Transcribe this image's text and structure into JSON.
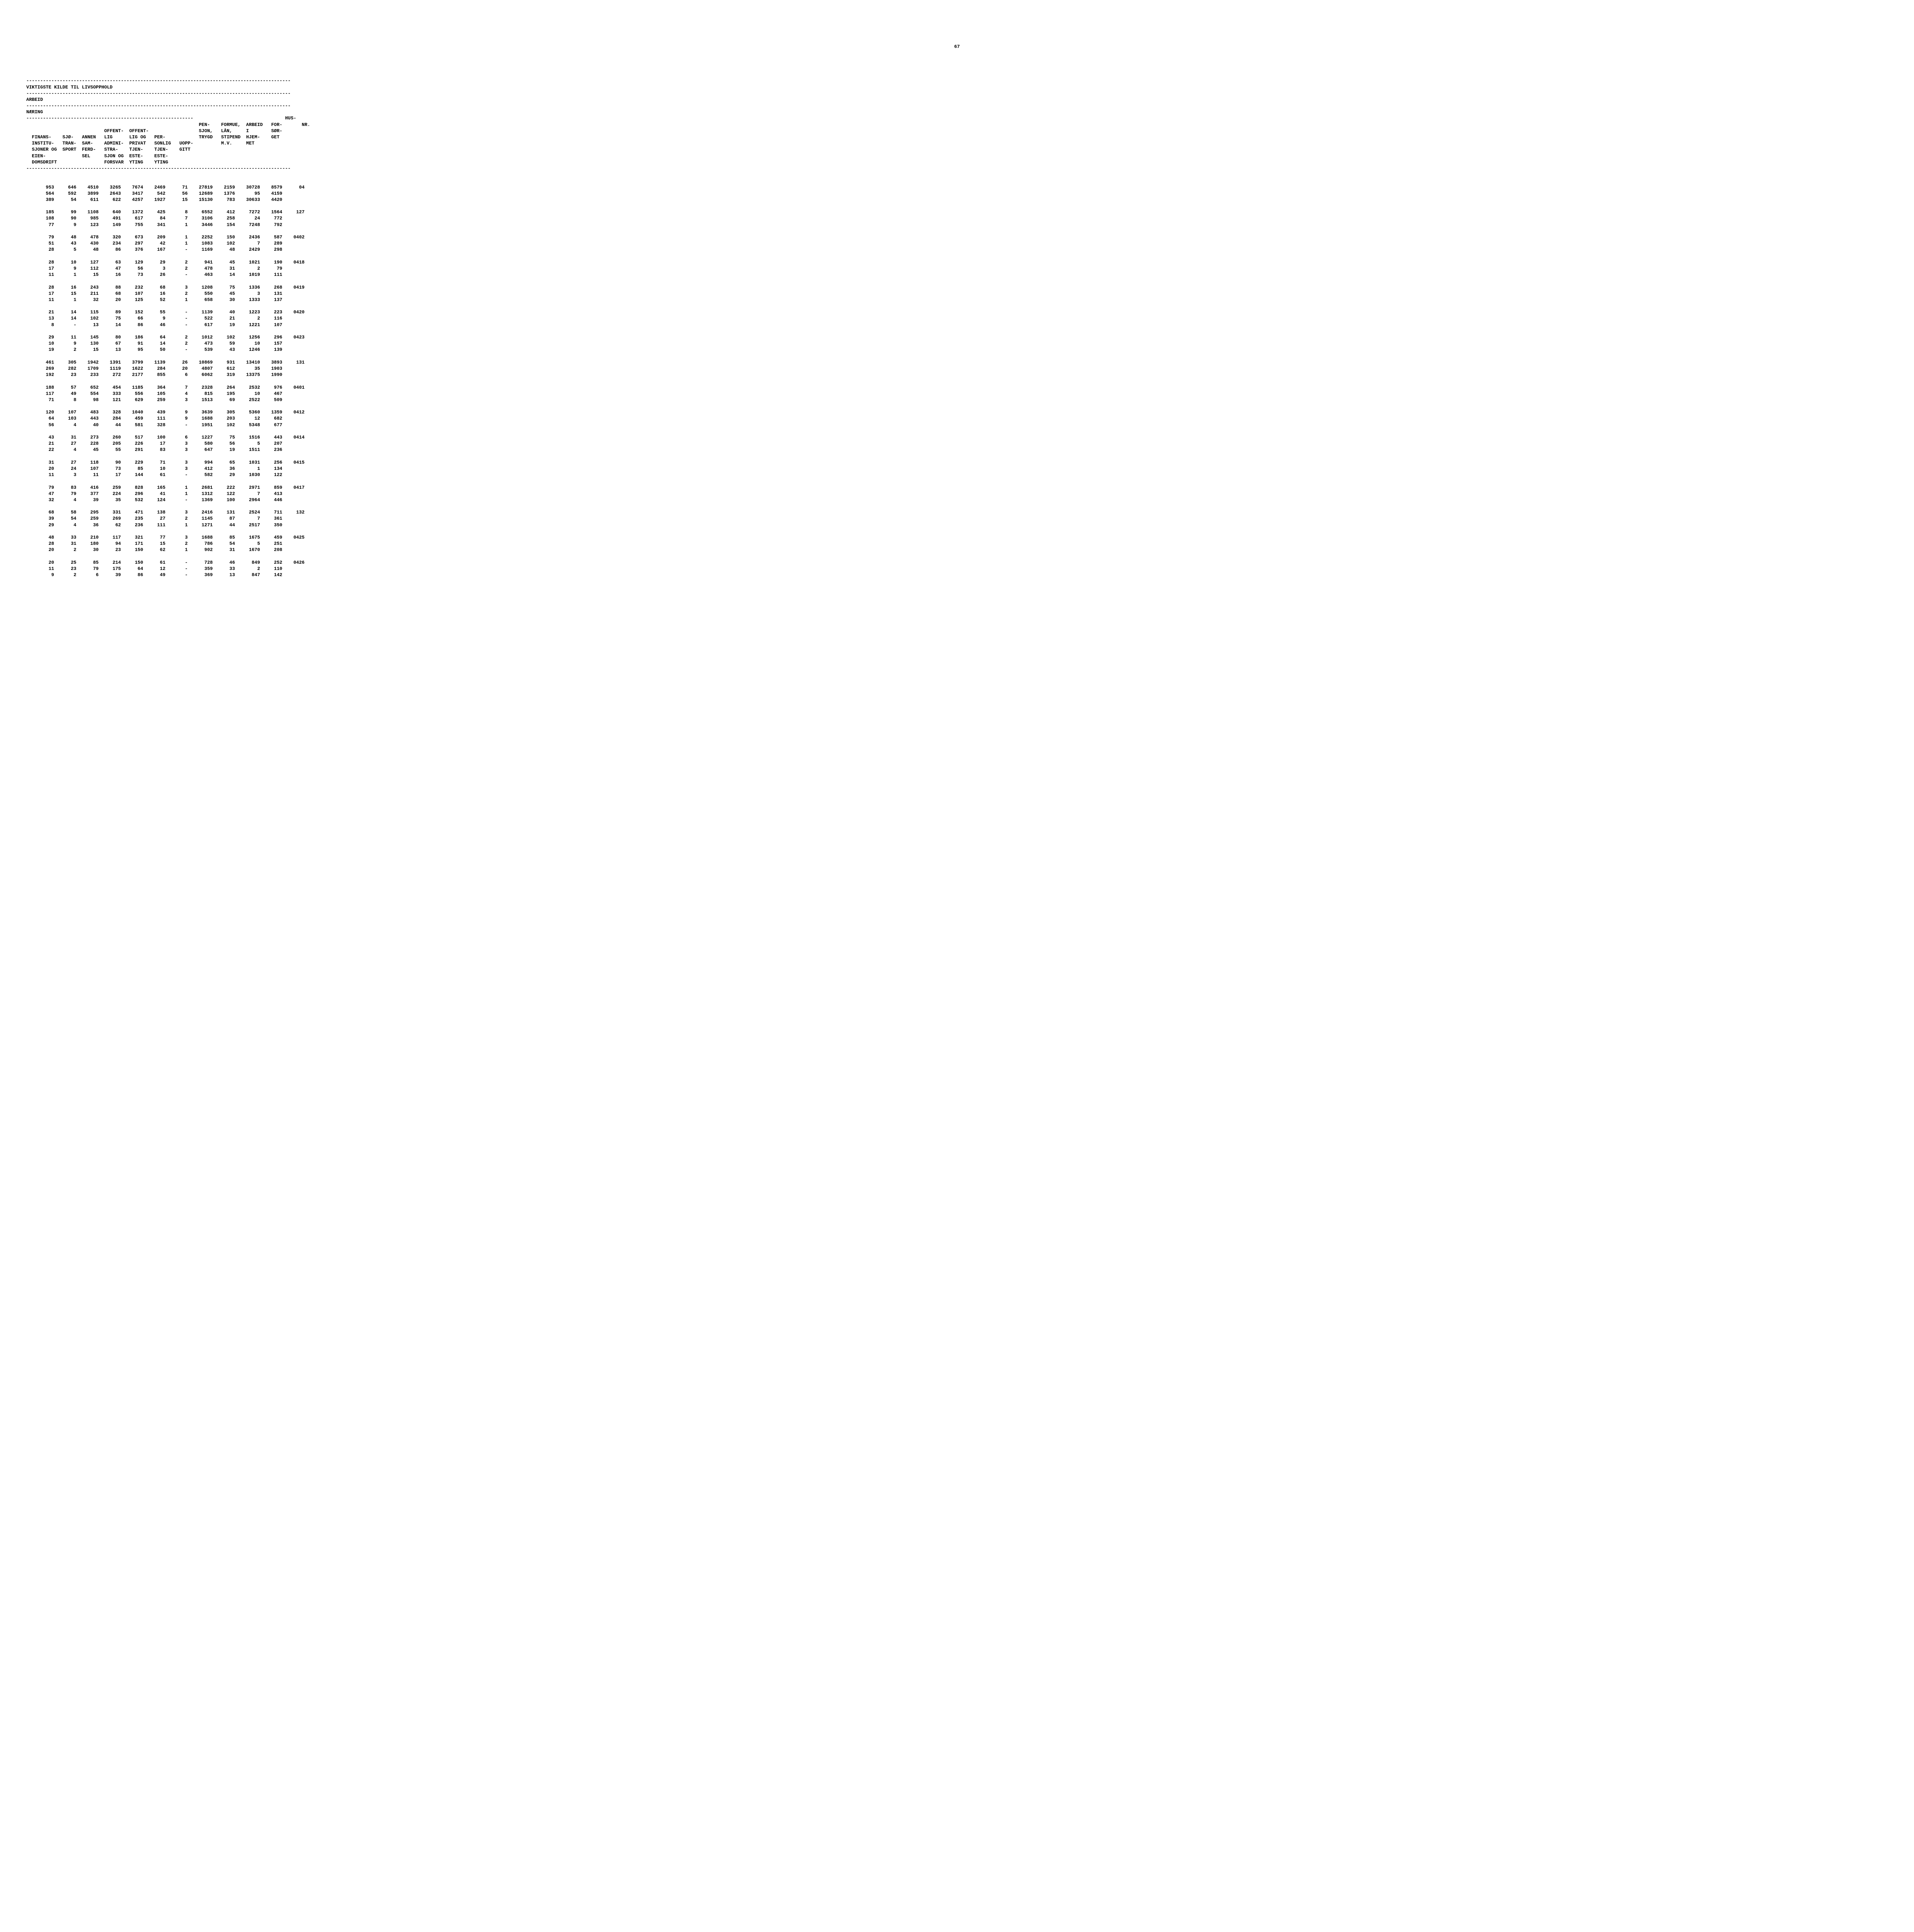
{
  "page_number": "67",
  "title": "VIKTIGSTE KILDE TIL LIVSOPPHOLD",
  "section1": "ARBEID",
  "section2": "NÆRING",
  "headers": {
    "col1": "FINANS-\nINSTITU-\nSJONER OG\nEIEN-\nDOMSDRIFT",
    "col2": "SJØ-\nTRAN-\nSPORT",
    "col3": "ANNEN\nSAM-\nFERD-\nSEL",
    "col4": "OFFENT-\nLIG\nADMINI-\nSTRA-\nSJON OG\nFORSVAR",
    "col5": "OFFENT-\nLIG OG\nPRIVAT\nTJEN-\nESTE-\nYTING",
    "col6": "PER-\nSONLIG\nTJEN-\nESTE-\nYTING",
    "col7": "UOPP-\nGITT",
    "col8": "PEN-\nSJON,\nTRYGD",
    "col9": "FORMUE,\nLÅN,\nSTIPEND\nM.V.",
    "col10": "HUS-\nARBEID\nI\nHJEM-\nMET",
    "col11": "FOR-\nSØR-\nGET",
    "col12": "NR."
  },
  "chart_data": {
    "type": "table",
    "rows": [
      {
        "c1": "953",
        "c2": "646",
        "c3": "4510",
        "c4": "3265",
        "c5": "7674",
        "c6": "2469",
        "c7": "71",
        "c8": "27819",
        "c9": "2159",
        "c10": "30728",
        "c11": "8579",
        "c12": "04"
      },
      {
        "c1": "564",
        "c2": "592",
        "c3": "3899",
        "c4": "2643",
        "c5": "3417",
        "c6": "542",
        "c7": "56",
        "c8": "12689",
        "c9": "1376",
        "c10": "95",
        "c11": "4159",
        "c12": ""
      },
      {
        "c1": "389",
        "c2": "54",
        "c3": "611",
        "c4": "622",
        "c5": "4257",
        "c6": "1927",
        "c7": "15",
        "c8": "15130",
        "c9": "783",
        "c10": "30633",
        "c11": "4420",
        "c12": ""
      },
      {
        "c1": "185",
        "c2": "99",
        "c3": "1108",
        "c4": "640",
        "c5": "1372",
        "c6": "425",
        "c7": "8",
        "c8": "6552",
        "c9": "412",
        "c10": "7272",
        "c11": "1564",
        "c12": "127"
      },
      {
        "c1": "108",
        "c2": "90",
        "c3": "985",
        "c4": "491",
        "c5": "617",
        "c6": "84",
        "c7": "7",
        "c8": "3106",
        "c9": "258",
        "c10": "24",
        "c11": "772",
        "c12": ""
      },
      {
        "c1": "77",
        "c2": "9",
        "c3": "123",
        "c4": "149",
        "c5": "755",
        "c6": "341",
        "c7": "1",
        "c8": "3446",
        "c9": "154",
        "c10": "7248",
        "c11": "792",
        "c12": ""
      },
      {
        "c1": "79",
        "c2": "48",
        "c3": "478",
        "c4": "320",
        "c5": "673",
        "c6": "209",
        "c7": "1",
        "c8": "2252",
        "c9": "150",
        "c10": "2436",
        "c11": "587",
        "c12": "0402"
      },
      {
        "c1": "51",
        "c2": "43",
        "c3": "430",
        "c4": "234",
        "c5": "297",
        "c6": "42",
        "c7": "1",
        "c8": "1083",
        "c9": "102",
        "c10": "7",
        "c11": "289",
        "c12": ""
      },
      {
        "c1": "28",
        "c2": "5",
        "c3": "48",
        "c4": "86",
        "c5": "376",
        "c6": "167",
        "c7": "-",
        "c8": "1169",
        "c9": "48",
        "c10": "2429",
        "c11": "298",
        "c12": ""
      },
      {
        "c1": "28",
        "c2": "10",
        "c3": "127",
        "c4": "63",
        "c5": "129",
        "c6": "29",
        "c7": "2",
        "c8": "941",
        "c9": "45",
        "c10": "1021",
        "c11": "190",
        "c12": "0418"
      },
      {
        "c1": "17",
        "c2": "9",
        "c3": "112",
        "c4": "47",
        "c5": "56",
        "c6": "3",
        "c7": "2",
        "c8": "478",
        "c9": "31",
        "c10": "2",
        "c11": "79",
        "c12": ""
      },
      {
        "c1": "11",
        "c2": "1",
        "c3": "15",
        "c4": "16",
        "c5": "73",
        "c6": "26",
        "c7": "-",
        "c8": "463",
        "c9": "14",
        "c10": "1019",
        "c11": "111",
        "c12": ""
      },
      {
        "c1": "28",
        "c2": "16",
        "c3": "243",
        "c4": "88",
        "c5": "232",
        "c6": "68",
        "c7": "3",
        "c8": "1208",
        "c9": "75",
        "c10": "1336",
        "c11": "268",
        "c12": "0419"
      },
      {
        "c1": "17",
        "c2": "15",
        "c3": "211",
        "c4": "68",
        "c5": "107",
        "c6": "16",
        "c7": "2",
        "c8": "550",
        "c9": "45",
        "c10": "3",
        "c11": "131",
        "c12": ""
      },
      {
        "c1": "11",
        "c2": "1",
        "c3": "32",
        "c4": "20",
        "c5": "125",
        "c6": "52",
        "c7": "1",
        "c8": "658",
        "c9": "30",
        "c10": "1333",
        "c11": "137",
        "c12": ""
      },
      {
        "c1": "21",
        "c2": "14",
        "c3": "115",
        "c4": "89",
        "c5": "152",
        "c6": "55",
        "c7": "-",
        "c8": "1139",
        "c9": "40",
        "c10": "1223",
        "c11": "223",
        "c12": "0420"
      },
      {
        "c1": "13",
        "c2": "14",
        "c3": "102",
        "c4": "75",
        "c5": "66",
        "c6": "9",
        "c7": "-",
        "c8": "522",
        "c9": "21",
        "c10": "2",
        "c11": "116",
        "c12": ""
      },
      {
        "c1": "8",
        "c2": "-",
        "c3": "13",
        "c4": "14",
        "c5": "86",
        "c6": "46",
        "c7": "-",
        "c8": "617",
        "c9": "19",
        "c10": "1221",
        "c11": "107",
        "c12": ""
      },
      {
        "c1": "29",
        "c2": "11",
        "c3": "145",
        "c4": "80",
        "c5": "186",
        "c6": "64",
        "c7": "2",
        "c8": "1012",
        "c9": "102",
        "c10": "1256",
        "c11": "296",
        "c12": "0423"
      },
      {
        "c1": "10",
        "c2": "9",
        "c3": "130",
        "c4": "67",
        "c5": "91",
        "c6": "14",
        "c7": "2",
        "c8": "473",
        "c9": "59",
        "c10": "10",
        "c11": "157",
        "c12": ""
      },
      {
        "c1": "19",
        "c2": "2",
        "c3": "15",
        "c4": "13",
        "c5": "95",
        "c6": "50",
        "c7": "-",
        "c8": "539",
        "c9": "43",
        "c10": "1246",
        "c11": "139",
        "c12": ""
      },
      {
        "c1": "461",
        "c2": "305",
        "c3": "1942",
        "c4": "1391",
        "c5": "3799",
        "c6": "1139",
        "c7": "26",
        "c8": "10869",
        "c9": "931",
        "c10": "13410",
        "c11": "3893",
        "c12": "131"
      },
      {
        "c1": "269",
        "c2": "282",
        "c3": "1709",
        "c4": "1119",
        "c5": "1622",
        "c6": "284",
        "c7": "20",
        "c8": "4807",
        "c9": "612",
        "c10": "35",
        "c11": "1903",
        "c12": ""
      },
      {
        "c1": "192",
        "c2": "23",
        "c3": "233",
        "c4": "272",
        "c5": "2177",
        "c6": "855",
        "c7": "6",
        "c8": "6062",
        "c9": "319",
        "c10": "13375",
        "c11": "1990",
        "c12": ""
      },
      {
        "c1": "188",
        "c2": "57",
        "c3": "652",
        "c4": "454",
        "c5": "1185",
        "c6": "364",
        "c7": "7",
        "c8": "2328",
        "c9": "264",
        "c10": "2532",
        "c11": "976",
        "c12": "0401"
      },
      {
        "c1": "117",
        "c2": "49",
        "c3": "554",
        "c4": "333",
        "c5": "556",
        "c6": "105",
        "c7": "4",
        "c8": "815",
        "c9": "195",
        "c10": "10",
        "c11": "467",
        "c12": ""
      },
      {
        "c1": "71",
        "c2": "8",
        "c3": "98",
        "c4": "121",
        "c5": "629",
        "c6": "259",
        "c7": "3",
        "c8": "1513",
        "c9": "69",
        "c10": "2522",
        "c11": "509",
        "c12": ""
      },
      {
        "c1": "120",
        "c2": "107",
        "c3": "483",
        "c4": "328",
        "c5": "1040",
        "c6": "439",
        "c7": "9",
        "c8": "3639",
        "c9": "305",
        "c10": "5360",
        "c11": "1359",
        "c12": "0412"
      },
      {
        "c1": "64",
        "c2": "103",
        "c3": "443",
        "c4": "284",
        "c5": "459",
        "c6": "111",
        "c7": "9",
        "c8": "1688",
        "c9": "203",
        "c10": "12",
        "c11": "682",
        "c12": ""
      },
      {
        "c1": "56",
        "c2": "4",
        "c3": "40",
        "c4": "44",
        "c5": "581",
        "c6": "328",
        "c7": "-",
        "c8": "1951",
        "c9": "102",
        "c10": "5348",
        "c11": "677",
        "c12": ""
      },
      {
        "c1": "43",
        "c2": "31",
        "c3": "273",
        "c4": "260",
        "c5": "517",
        "c6": "100",
        "c7": "6",
        "c8": "1227",
        "c9": "75",
        "c10": "1516",
        "c11": "443",
        "c12": "0414"
      },
      {
        "c1": "21",
        "c2": "27",
        "c3": "228",
        "c4": "205",
        "c5": "226",
        "c6": "17",
        "c7": "3",
        "c8": "580",
        "c9": "56",
        "c10": "5",
        "c11": "207",
        "c12": ""
      },
      {
        "c1": "22",
        "c2": "4",
        "c3": "45",
        "c4": "55",
        "c5": "291",
        "c6": "83",
        "c7": "3",
        "c8": "647",
        "c9": "19",
        "c10": "1511",
        "c11": "236",
        "c12": ""
      },
      {
        "c1": "31",
        "c2": "27",
        "c3": "118",
        "c4": "90",
        "c5": "229",
        "c6": "71",
        "c7": "3",
        "c8": "994",
        "c9": "65",
        "c10": "1031",
        "c11": "256",
        "c12": "0415"
      },
      {
        "c1": "20",
        "c2": "24",
        "c3": "107",
        "c4": "73",
        "c5": "85",
        "c6": "10",
        "c7": "3",
        "c8": "412",
        "c9": "36",
        "c10": "1",
        "c11": "134",
        "c12": ""
      },
      {
        "c1": "11",
        "c2": "3",
        "c3": "11",
        "c4": "17",
        "c5": "144",
        "c6": "61",
        "c7": "-",
        "c8": "582",
        "c9": "29",
        "c10": "1030",
        "c11": "122",
        "c12": ""
      },
      {
        "c1": "79",
        "c2": "83",
        "c3": "416",
        "c4": "259",
        "c5": "828",
        "c6": "165",
        "c7": "1",
        "c8": "2681",
        "c9": "222",
        "c10": "2971",
        "c11": "859",
        "c12": "0417"
      },
      {
        "c1": "47",
        "c2": "79",
        "c3": "377",
        "c4": "224",
        "c5": "296",
        "c6": "41",
        "c7": "1",
        "c8": "1312",
        "c9": "122",
        "c10": "7",
        "c11": "413",
        "c12": ""
      },
      {
        "c1": "32",
        "c2": "4",
        "c3": "39",
        "c4": "35",
        "c5": "532",
        "c6": "124",
        "c7": "-",
        "c8": "1369",
        "c9": "100",
        "c10": "2964",
        "c11": "446",
        "c12": ""
      },
      {
        "c1": "68",
        "c2": "58",
        "c3": "295",
        "c4": "331",
        "c5": "471",
        "c6": "138",
        "c7": "3",
        "c8": "2416",
        "c9": "131",
        "c10": "2524",
        "c11": "711",
        "c12": "132"
      },
      {
        "c1": "39",
        "c2": "54",
        "c3": "259",
        "c4": "269",
        "c5": "235",
        "c6": "27",
        "c7": "2",
        "c8": "1145",
        "c9": "87",
        "c10": "7",
        "c11": "361",
        "c12": ""
      },
      {
        "c1": "29",
        "c2": "4",
        "c3": "36",
        "c4": "62",
        "c5": "236",
        "c6": "111",
        "c7": "1",
        "c8": "1271",
        "c9": "44",
        "c10": "2517",
        "c11": "350",
        "c12": ""
      },
      {
        "c1": "48",
        "c2": "33",
        "c3": "210",
        "c4": "117",
        "c5": "321",
        "c6": "77",
        "c7": "3",
        "c8": "1688",
        "c9": "85",
        "c10": "1675",
        "c11": "459",
        "c12": "0425"
      },
      {
        "c1": "28",
        "c2": "31",
        "c3": "180",
        "c4": "94",
        "c5": "171",
        "c6": "15",
        "c7": "2",
        "c8": "786",
        "c9": "54",
        "c10": "5",
        "c11": "251",
        "c12": ""
      },
      {
        "c1": "20",
        "c2": "2",
        "c3": "30",
        "c4": "23",
        "c5": "150",
        "c6": "62",
        "c7": "1",
        "c8": "902",
        "c9": "31",
        "c10": "1670",
        "c11": "208",
        "c12": ""
      },
      {
        "c1": "20",
        "c2": "25",
        "c3": "85",
        "c4": "214",
        "c5": "150",
        "c6": "61",
        "c7": "-",
        "c8": "728",
        "c9": "46",
        "c10": "849",
        "c11": "252",
        "c12": "0426"
      },
      {
        "c1": "11",
        "c2": "23",
        "c3": "79",
        "c4": "175",
        "c5": "64",
        "c6": "12",
        "c7": "-",
        "c8": "359",
        "c9": "33",
        "c10": "2",
        "c11": "110",
        "c12": ""
      },
      {
        "c1": "9",
        "c2": "2",
        "c3": "6",
        "c4": "39",
        "c5": "86",
        "c6": "49",
        "c7": "-",
        "c8": "369",
        "c9": "13",
        "c10": "847",
        "c11": "142",
        "c12": ""
      }
    ]
  }
}
